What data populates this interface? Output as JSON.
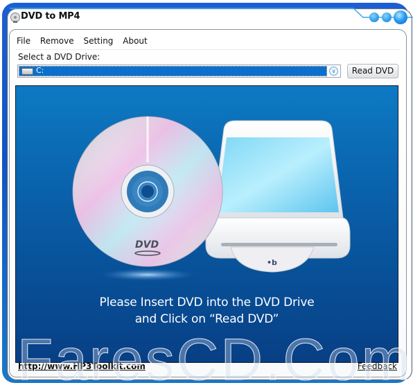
{
  "window": {
    "title": "DVD to MP4"
  },
  "menu": {
    "items": [
      {
        "label": "File"
      },
      {
        "label": "Remove"
      },
      {
        "label": "Setting"
      },
      {
        "label": "About"
      }
    ]
  },
  "drive_selector": {
    "label": "Select a DVD Drive:",
    "selected_value": "C:",
    "read_button_label": "Read DVD"
  },
  "stage": {
    "message_line1": "Please Insert DVD into the DVD Drive",
    "message_line2": "and Click on “Read DVD”",
    "disc_logo": "DVD",
    "drive_logo": "blu-ray-logo"
  },
  "footer": {
    "website_link": "http://www.HP3Toolkit.com",
    "feedback_link": "Feedback"
  },
  "watermark": {
    "text": "FaresCD.Com"
  },
  "colors": {
    "frame_blue": "#0f54c8",
    "selection_blue": "#0a6fcd",
    "stage_top": "#0d7ac3",
    "stage_bottom": "#083f85",
    "accent_dot": "#2a9ef0"
  }
}
